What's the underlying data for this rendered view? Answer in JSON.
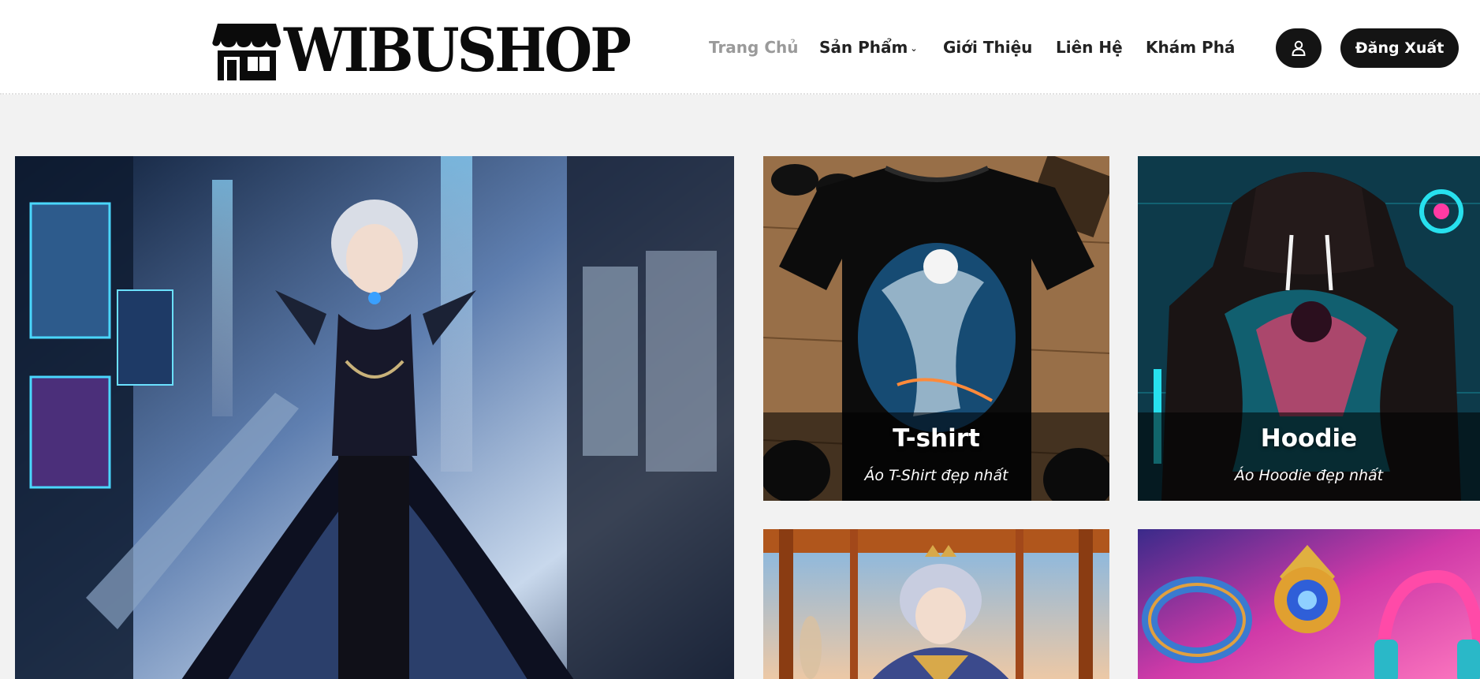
{
  "brand": {
    "name": "WIBUSHOP"
  },
  "nav": {
    "items": [
      {
        "label": "Trang Chủ",
        "active": true
      },
      {
        "label": "Sản Phẩm",
        "has_dropdown": true
      },
      {
        "label": "Giới Thiệu"
      },
      {
        "label": "Liên Hệ"
      },
      {
        "label": "Khám Phá"
      }
    ],
    "account_icon": "user-icon",
    "logout_label": "Đăng Xuất"
  },
  "products": [
    {
      "title": "T-shirt",
      "subtitle": "Áo T-Shirt đẹp nhất"
    },
    {
      "title": "Hoodie",
      "subtitle": "Áo Hoodie đẹp nhất"
    }
  ],
  "colors": {
    "header_bg": "#ffffff",
    "page_bg": "#f2f2f2",
    "button_bg": "#141414",
    "nav_active": "#9a9a9a",
    "nav_text": "#222222"
  }
}
